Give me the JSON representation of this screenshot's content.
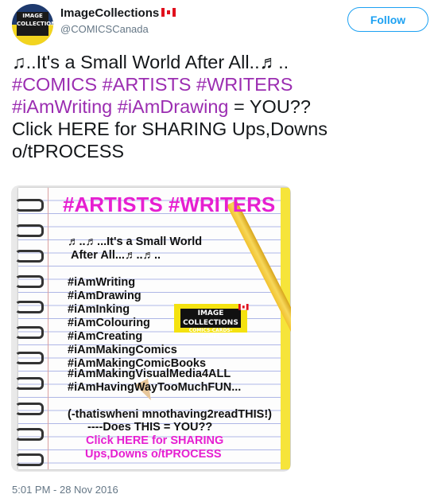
{
  "header": {
    "display_name": "ImageCollections",
    "handle": "@COMICSCanada",
    "follow_label": "Follow",
    "avatar_text": "IMAGE COLLECTIONS"
  },
  "tweet": {
    "line1": "♫..It's a Small World After All..♬..",
    "line2": "#COMICS #ARTISTS #WRITERS",
    "line3_tag1": "#iAmWriting",
    "line3_tag2": "#iAmDrawing",
    "line3_rest": " = YOU??",
    "line4": "Click HERE for SHARING Ups,Downs",
    "line5": "o/tPROCESS"
  },
  "media": {
    "title": "#ARTISTS #WRITERS",
    "lines": [
      "♬..♬...It's a Small World",
      "After All...♬..♬..",
      "#iAmWriting",
      "#iAmDrawing",
      "#iAmInking",
      "#iAmColouring",
      "#iAmCreating",
      "#iAmMakingComics",
      "#iAmMakingComicBooks",
      "#iAmMakingVisualMedia4ALL",
      "#iAmHavingWayTooMuchFUN...",
      "(-thatiswheni mnothaving2readTHIS!)",
      "----Does THIS = YOU??"
    ],
    "link1": "Click HERE for SHARING",
    "link2": "Ups,Downs o/tPROCESS",
    "logo_text": "IMAGE COLLECTIONS",
    "logo_sub": "COMICS-CARDS-GAMES"
  },
  "timestamp": "5:01 PM - 28 Nov 2016",
  "colors": {
    "hashtag": "#9b2db1",
    "follow": "#1da1f2",
    "notebook_pink": "#e61fd1",
    "notebook_edge": "#f6e43a"
  }
}
